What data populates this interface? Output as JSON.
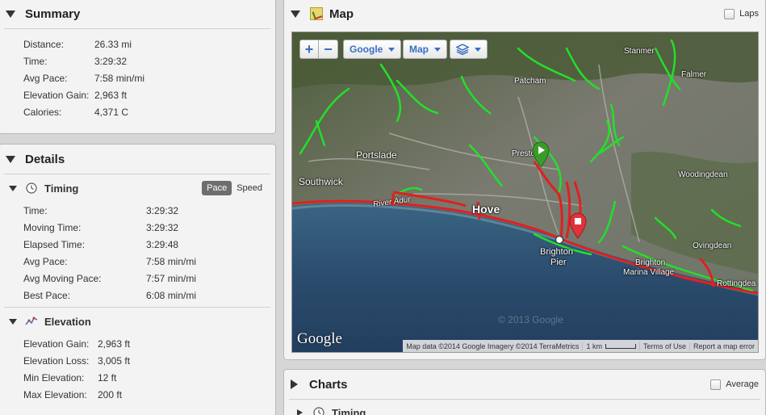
{
  "summary": {
    "title": "Summary",
    "rows": [
      {
        "label": "Distance:",
        "value": "26.33 mi"
      },
      {
        "label": "Time:",
        "value": "3:29:32"
      },
      {
        "label": "Avg Pace:",
        "value": "7:58 min/mi"
      },
      {
        "label": "Elevation Gain:",
        "value": "2,963 ft"
      },
      {
        "label": "Calories:",
        "value": "4,371 C"
      }
    ]
  },
  "details": {
    "title": "Details",
    "timing": {
      "title": "Timing",
      "icon": "clock-icon",
      "toggle": {
        "pace": "Pace",
        "speed": "Speed",
        "selected": "Pace"
      },
      "rows": [
        {
          "label": "Time:",
          "value": "3:29:32"
        },
        {
          "label": "Moving Time:",
          "value": "3:29:32"
        },
        {
          "label": "Elapsed Time:",
          "value": "3:29:48"
        },
        {
          "label": "Avg Pace:",
          "value": "7:58 min/mi"
        },
        {
          "label": "Avg Moving Pace:",
          "value": "7:57 min/mi"
        },
        {
          "label": "Best Pace:",
          "value": "6:08 min/mi"
        }
      ]
    },
    "elevation": {
      "title": "Elevation",
      "icon": "elevation-chart-icon",
      "rows": [
        {
          "label": "Elevation Gain:",
          "value": "2,963 ft"
        },
        {
          "label": "Elevation Loss:",
          "value": "3,005 ft"
        },
        {
          "label": "Min Elevation:",
          "value": "12 ft"
        },
        {
          "label": "Max Elevation:",
          "value": "200 ft"
        }
      ]
    }
  },
  "map": {
    "title": "Map",
    "laps_label": "Laps",
    "controls": {
      "zoom_in": "+",
      "zoom_out": "−",
      "provider": "Google",
      "map_type": "Map"
    },
    "places": {
      "stanmer": "Stanmer",
      "falmer": "Falmer",
      "patcham": "Patcham",
      "portslade": "Portslade",
      "preston": "Presto",
      "woodingdean": "Woodingdean",
      "southwick": "Southwick",
      "river_adur": "River Adur",
      "hove": "Hove",
      "brighton_pier_1": "Brighton",
      "brighton_pier_2": "Pier",
      "brighton_marina_1": "Brighton",
      "brighton_marina_2": "Marina Village",
      "ovingdean": "Ovingdean",
      "rottingdean": "Rottingdea"
    },
    "logo": "Google",
    "watermark": "© 2013 Google",
    "attribution": {
      "data": "Map data ©2014 Google Imagery ©2014 TerraMetrics",
      "scale": "1 km",
      "terms": "Terms of Use",
      "report": "Report a map error"
    },
    "colors": {
      "route": "#e02020",
      "paths": "#22e02a",
      "sea": "#2a4a6e",
      "land": "#6f7466"
    }
  },
  "charts": {
    "title": "Charts",
    "average_label": "Average",
    "sub_title": "Timing"
  }
}
